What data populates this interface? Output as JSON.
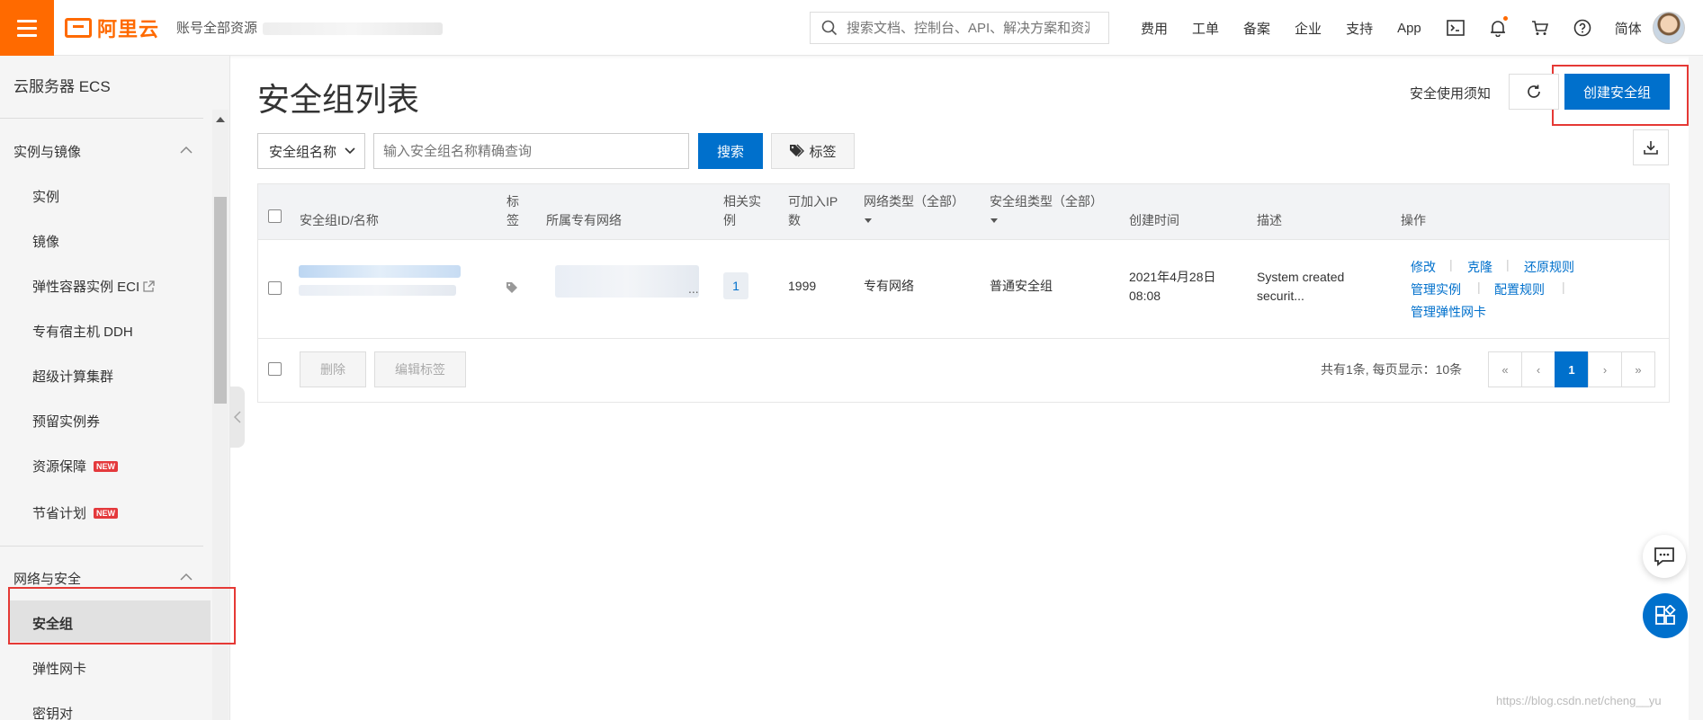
{
  "topbar": {
    "logo_text": "阿里云",
    "account_label": "账号全部资源",
    "search_placeholder": "搜索文档、控制台、API、解决方案和资源",
    "nav": [
      "费用",
      "工单",
      "备案",
      "企业",
      "支持",
      "App"
    ],
    "lang": "简体",
    "icons": [
      "terminal-icon",
      "bell-icon",
      "cart-icon",
      "help-icon"
    ]
  },
  "sidebar": {
    "title": "云服务器 ECS",
    "group1": {
      "title": "实例与镜像",
      "items": [
        "实例",
        "镜像",
        "弹性容器实例 ECI",
        "专有宿主机 DDH",
        "超级计算集群",
        "预留实例券",
        "资源保障",
        "节省计划"
      ]
    },
    "new_badge": "NEW",
    "group2": {
      "title": "网络与安全",
      "items": [
        "安全组",
        "弹性网卡",
        "密钥对"
      ]
    }
  },
  "main": {
    "title": "安全组列表",
    "notice_link": "安全使用须知",
    "create_button": "创建安全组",
    "filter": {
      "select_value": "安全组名称",
      "input_placeholder": "输入安全组名称精确查询",
      "search_button": "搜索",
      "tag_button": "标签"
    },
    "table": {
      "headers": {
        "id_name": "安全组ID/名称",
        "tag_1": "标",
        "tag_2": "签",
        "vpc": "所属专有网络",
        "instances_1": "相关实",
        "instances_2": "例",
        "ip_1": "可加入IP",
        "ip_2": "数",
        "net_type": "网络类型（全部）",
        "sg_type": "安全组类型（全部）",
        "created": "创建时间",
        "desc": "描述",
        "ops": "操作"
      },
      "rows": [
        {
          "instances": "1",
          "ip_count": "1999",
          "net_type": "专有网络",
          "sg_type": "普通安全组",
          "created_date": "2021年4月28日",
          "created_time": "08:08",
          "desc_1": "System created",
          "desc_2": "securit...",
          "vpc_ellipsis": "...",
          "ops": {
            "modify": "修改",
            "clone": "克隆",
            "restore": "还原规则",
            "manage_instances": "管理实例",
            "config_rules": "配置规则",
            "manage_eni": "管理弹性网卡"
          }
        }
      ]
    },
    "footer": {
      "delete_button": "删除",
      "edit_tags_button": "编辑标签",
      "page_info": "共有1条, 每页显示：10条",
      "pager": [
        "«",
        "‹",
        "1",
        "›",
        "»"
      ]
    }
  },
  "watermark": "https://blog.csdn.net/cheng__yu",
  "colors": {
    "brand_orange": "#ff6a00",
    "primary_blue": "#0070cc",
    "highlight_red": "#e53935"
  }
}
